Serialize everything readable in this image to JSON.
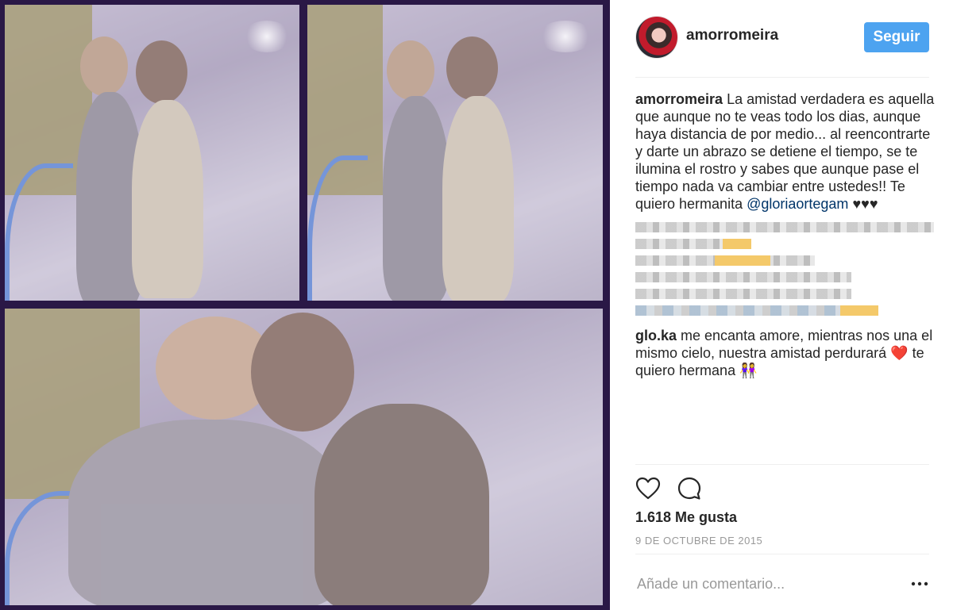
{
  "post": {
    "username": "amorromeira",
    "follow_label": "Seguir"
  },
  "caption": {
    "username": "amorromeira",
    "text": "La amistad verdadera es aquella que aunque no te veas todo los dias, aunque haya distancia de por medio... al reencontrarte y darte un abrazo se detiene el tiempo, se te ilumina el rostro y sabes que aunque pase el tiempo nada va cambiar entre ustedes!! Te quiero hermanita ",
    "mention": "@gloriaortegam",
    "hearts": "♥♥♥"
  },
  "comment": {
    "username": "glo.ka",
    "text_before": " me encanta amore, mientras nos una el mismo cielo, nuestra amistad perdurará ",
    "heart": "❤️",
    "text_after": " te quiero hermana ",
    "emoji": "👭"
  },
  "likes": "1.618 Me gusta",
  "date": "9 DE OCTUBRE DE 2015",
  "add_comment_placeholder": "Añade un comentario...",
  "more_label": "•••",
  "icons": [
    "heart-icon",
    "comment-icon",
    "more-options-icon"
  ],
  "colors": {
    "follow_button": "#4da3f0",
    "mention": "#003569",
    "collage_border": "#2a1846"
  }
}
